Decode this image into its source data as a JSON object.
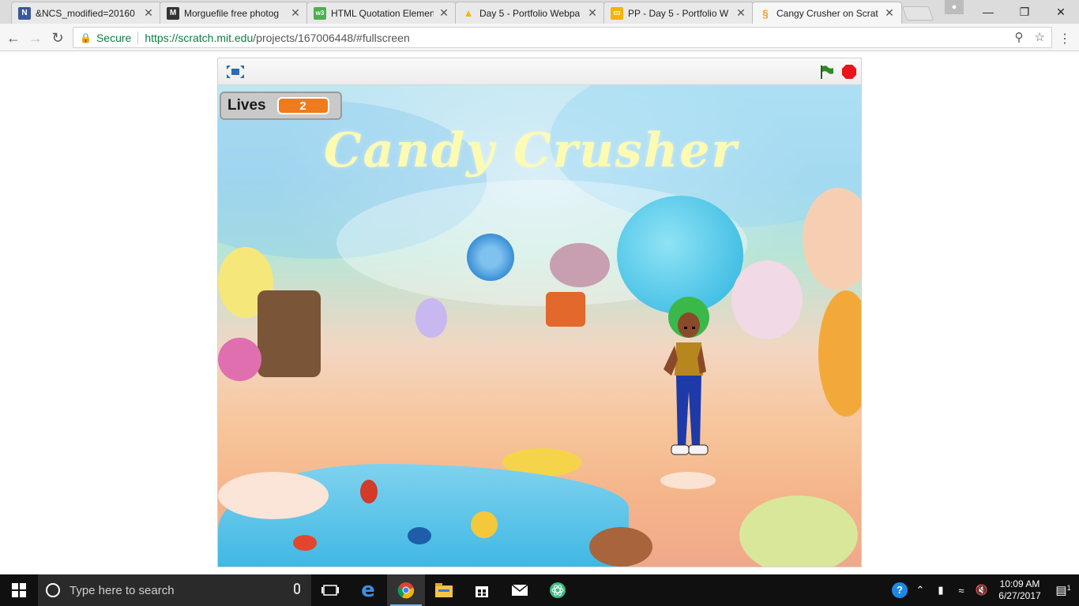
{
  "browser": {
    "tabs": [
      {
        "title": "&NCS_modified=20160",
        "icon": "n-icon",
        "color": "#3b5998",
        "glyph": "N"
      },
      {
        "title": "Morguefile free photog",
        "icon": "morguefile-icon",
        "color": "#333333",
        "glyph": "M"
      },
      {
        "title": "HTML Quotation Elemen",
        "icon": "w3schools-icon",
        "color": "#4caf50",
        "glyph": "w3"
      },
      {
        "title": "Day 5 - Portfolio Webpa",
        "icon": "google-drive-icon",
        "color": "#f4b400",
        "glyph": "▲"
      },
      {
        "title": "PP - Day 5 - Portfolio W",
        "icon": "google-slides-icon",
        "color": "#f4b400",
        "glyph": "▭"
      },
      {
        "title": "Cangy Crusher on Scrat",
        "icon": "scratch-icon",
        "color": "#f7a31d",
        "glyph": "S"
      }
    ],
    "address": {
      "secure_label": "Secure",
      "url_host": "https://scratch.mit.edu",
      "url_path": "/projects/167006448/#fullscreen"
    }
  },
  "game": {
    "title": "Candy Crusher",
    "lives_label": "Lives",
    "lives_value": "2"
  },
  "taskbar": {
    "search_placeholder": "Type here to search",
    "time": "10:09 AM",
    "date": "6/27/2017",
    "notification_count": "1"
  }
}
